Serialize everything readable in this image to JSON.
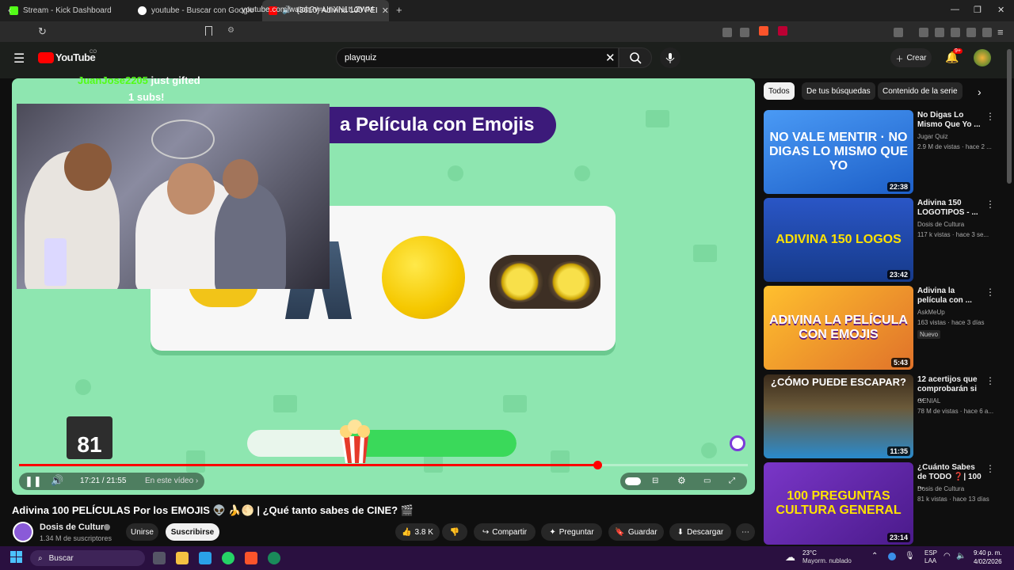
{
  "browser": {
    "tabs": [
      {
        "label": "Stream - Kick Dashboard",
        "color": "#53fc18"
      },
      {
        "label": "youtube - Buscar con Google",
        "color": "#ffffff"
      },
      {
        "label": "(3610) Adivina 100 PELÍCULA",
        "color": "#ff0000"
      }
    ],
    "url": "youtube.com/watch?v=UnXN1tLZWM"
  },
  "yt": {
    "logo": "YouTube",
    "country": "CO",
    "search_value": "playquiz",
    "create_label": "Crear",
    "notif_badge": "9+"
  },
  "video": {
    "banner": "a Película con Emojis",
    "gift_user": "JuanJose2205",
    "gift_text": "just gifted",
    "gift_subs": "1 subs!",
    "counter": "81",
    "time": "17:21 / 21:55",
    "chapter": "En este vídeo",
    "progress_fraction": 0.793,
    "answer_bar_fraction": 0.62,
    "accent": "#ff0000"
  },
  "below": {
    "title": "Adivina 100 PELÍCULAS Por los EMOJIS 👽 🍌🌕 | ¿Qué tanto sabes de CINE? 🎬",
    "channel": "Dosis de Cultura",
    "subs": "1.34 M de suscriptores",
    "join": "Unirse",
    "subscribe": "Suscribirse",
    "likes": "3.8 K",
    "share": "Compartir",
    "ask": "Preguntar",
    "save": "Guardar",
    "download": "Descargar"
  },
  "sidebar": {
    "chips": [
      "Todos",
      "De tus búsquedas",
      "Contenido de la serie"
    ],
    "items": [
      {
        "thumb_text": "NO VALE MENTIR · NO DIGAS LO MISMO QUE YO",
        "duration": "22:38",
        "title": "No Digas Lo Mismo Que Yo ...",
        "channel": "Jugar Quiz",
        "views": "2.9 M de vistas · hace 2 ...",
        "bg": "#2a7de1"
      },
      {
        "thumb_text": "ADIVINA 150 LOGOS",
        "duration": "23:42",
        "title": "Adivina 150 LOGOTIPOS - ...",
        "channel": "Dosis de Cultura",
        "views": "117 k vistas · hace 3 se...",
        "bg": "#1e3f8a"
      },
      {
        "thumb_text": "ADIVINA LA PELÍCULA CON EMOJIS",
        "duration": "5:43",
        "title": "Adivina la película con ...",
        "channel": "AskMeUp",
        "views": "163 vistas · hace 3 días",
        "badge": "Nuevo",
        "bg": "#f4a020"
      },
      {
        "thumb_text": "¿CÓMO PUEDE ESCAPAR?",
        "duration": "11:35",
        "title": "12 acertijos que comprobarán si ...",
        "channel": "GENIAL",
        "views": "78 M de vistas · hace 6 a...",
        "bg": "#3a2a1a"
      },
      {
        "thumb_text": "100 PREGUNTAS CULTURA GENERAL",
        "duration": "23:14",
        "title": "¿Cuánto Sabes de TODO ❓| 100 ...",
        "channel": "Dosis de Cultura",
        "views": "81 k vistas · hace 13 días",
        "bg": "#6a2ab0"
      }
    ]
  },
  "taskbar": {
    "search": "Buscar",
    "temp": "23°C",
    "weather": "Mayorm. nublado",
    "lang1": "ESP",
    "lang2": "LAA",
    "time": "9:40 p. m.",
    "date": "4/02/2026"
  }
}
